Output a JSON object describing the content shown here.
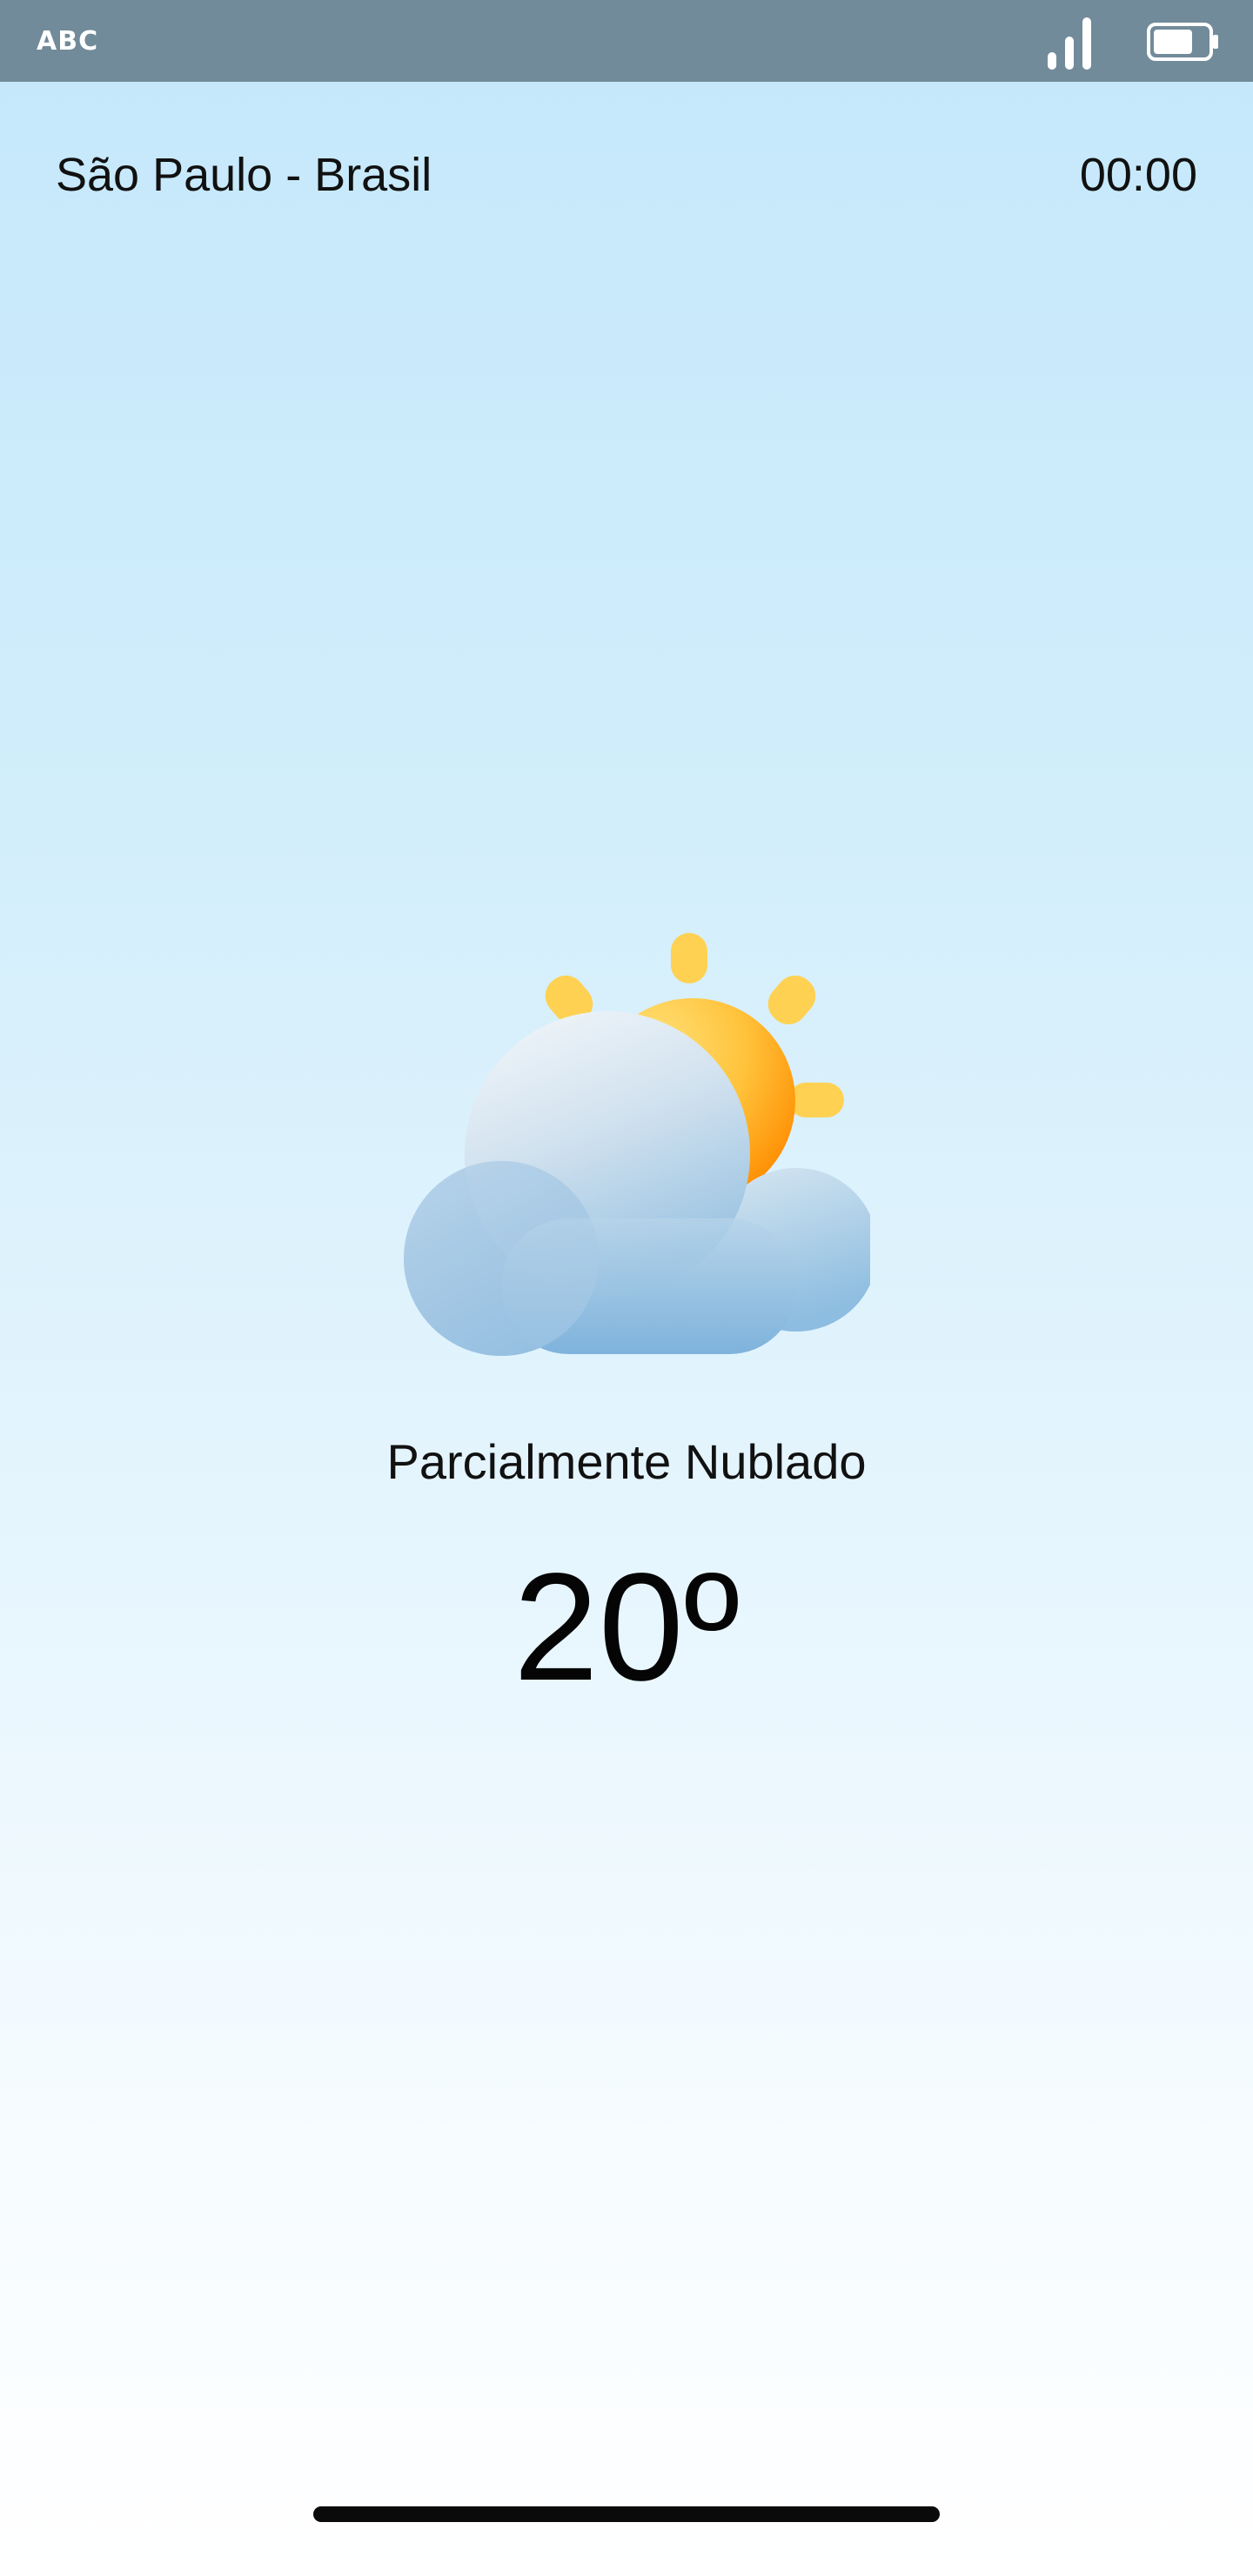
{
  "status_bar": {
    "carrier": "ABC",
    "signal_icon": "signal-strength-icon",
    "battery_icon": "battery-icon",
    "background_color": "#718b9a"
  },
  "header": {
    "location": "São Paulo - Brasil",
    "time": "00:00"
  },
  "weather": {
    "icon": "partly-cloudy-icon",
    "condition": "Parcialmente Nublado",
    "temperature": "20º"
  }
}
